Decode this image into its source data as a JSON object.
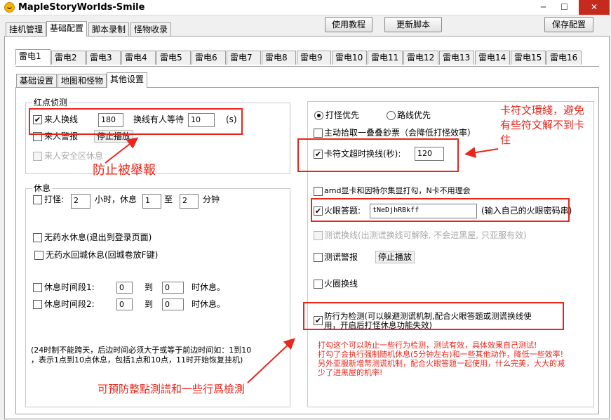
{
  "window": {
    "title": "MapleStoryWorlds-Smile",
    "minimize": "─",
    "maximize": "☐",
    "close": "✕"
  },
  "main_tabs": [
    "挂机管理",
    "基础配置",
    "脚本录制",
    "怪物收录"
  ],
  "buttons": {
    "tutorial": "使用教程",
    "update": "更新脚本",
    "save": "保存配置"
  },
  "thunder_tabs": [
    "雷电1",
    "雷电2",
    "雷电3",
    "雷电4",
    "雷电5",
    "雷电6",
    "雷电7",
    "雷电8",
    "雷电9",
    "雷电10",
    "雷电11",
    "雷电12",
    "雷电13",
    "雷电14",
    "雷电15",
    "雷电16"
  ],
  "sub_tabs": [
    "基础设置",
    "地图和怪物",
    "其他设置"
  ],
  "redpoint": {
    "title": "红点侦测",
    "switch_line": {
      "label": "来人换线",
      "value": "180",
      "wait_label": "换线有人等待",
      "wait_value": "10",
      "unit": "(s)"
    },
    "alarm": {
      "label": "来人警报",
      "button": "停止播放"
    },
    "safe_rest": {
      "label": "来人安全区休息"
    }
  },
  "rest": {
    "title": "休息",
    "play": {
      "label": "打怪:",
      "hours": "2",
      "hours_label": "小时，休息",
      "from": "1",
      "to_label": "至",
      "to": "2",
      "minutes_label": "分钟"
    },
    "no_potion_rest": "无药水休息(退出到登录页面)",
    "no_potion_return": "无药水回城休息(回城卷放F键)",
    "period1": {
      "label": "休息时间段1:",
      "from": "0",
      "to_label": "到",
      "to": "0",
      "suffix": "时休息。"
    },
    "period2": {
      "label": "休息时间段2:",
      "from": "0",
      "to_label": "到",
      "to": "0",
      "suffix": "时休息。"
    },
    "note_line1": "(24时制不能跨天，后边时间必须大于或等于前边时间如：1到10",
    "note_line2": "，表示1点到10点休息，包括1点和10点，11时开始恢复挂机)"
  },
  "right": {
    "radio_monster": "打怪优先",
    "radio_route": "路线优先",
    "auto_pickup": "主动拾取一叠叠鈔票（会降低打怪效率）",
    "rune_timeout": {
      "label": "卡符文超时换线(秒):",
      "value": "120"
    },
    "amd_option": "amd显卡和因特尔集显打勾，N卡不用理会",
    "fire_eye": {
      "label": "火眼答题:",
      "value": "tNeDjhRBkff",
      "hint": "(输入自己的火眼密码串)"
    },
    "detect_switch": "测谎换线(出测谎换线可解除, 不会进黑屋, 只亚服有效)",
    "detect_alarm": {
      "label": "测谎警报",
      "button": "停止播放"
    },
    "fire_ring": "火圈换线",
    "anti_detect_line1": "防行为检测(可以躲避测谎机制,配合火眼答题或测谎换线使",
    "anti_detect_line2": "用，开启后打怪休息功能失效)"
  },
  "annotations": {
    "prevent_report": "防止被舉報",
    "rune_note_line1": "卡符文環綫，避免",
    "rune_note_line2": "有些符文解不到卡",
    "rune_note_line3": "住",
    "anti_note_line1": "打勾这个可以防止一些行为检测，测试有效，具体效果自己测试!",
    "anti_note_line2": "打勾了会执行强制随机休息(5分钟左右)和一些其他动作，降低一些效率!",
    "anti_note_line3": "另外亚服新增幣测谎机制，配合火眼答题一起使用，什么完美，大大的减",
    "anti_note_line4": "少了进黑屋的机率!",
    "prevent_detect": "可預防整點測謊和一些行爲檢測"
  },
  "colors": {
    "accent_red": "#e8261b"
  }
}
